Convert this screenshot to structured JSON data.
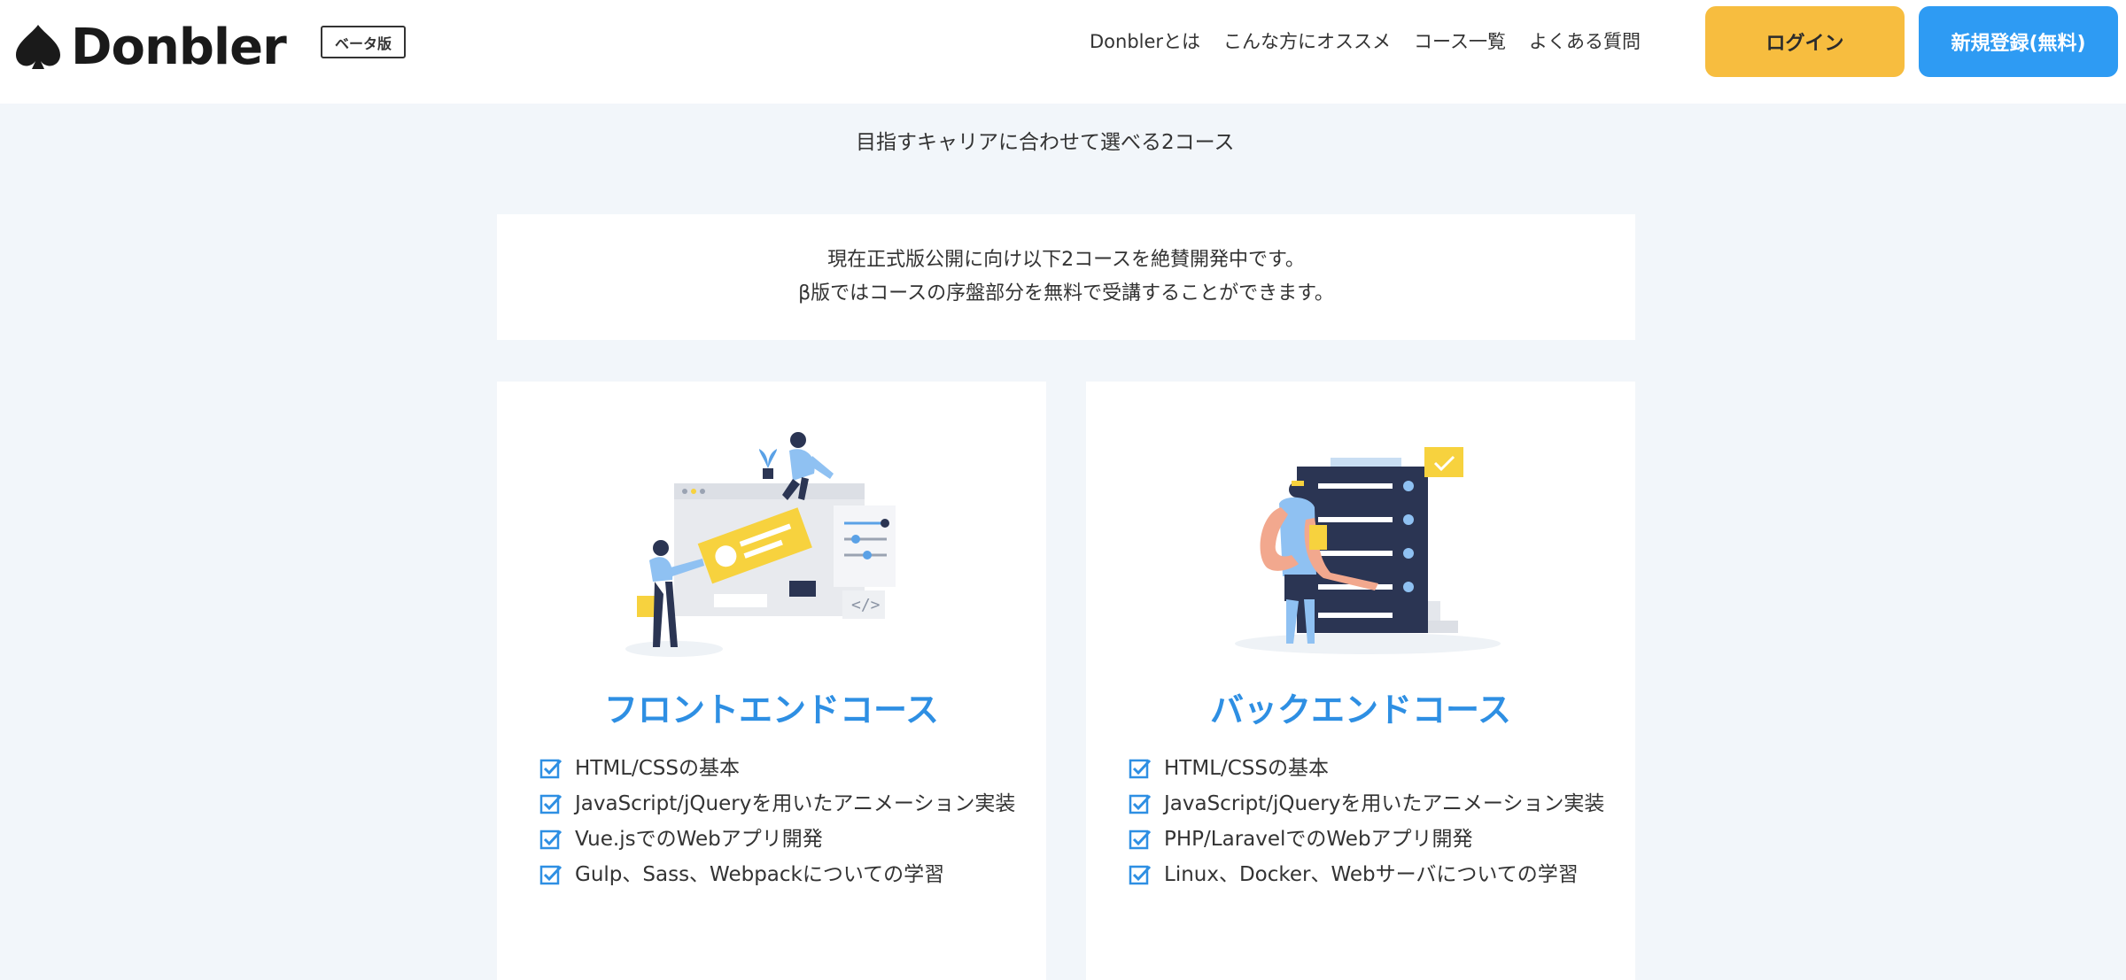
{
  "header": {
    "brand": "Donbler",
    "beta_label": "ベータ版",
    "nav": [
      "Donblerとは",
      "こんな方にオススメ",
      "コース一覧",
      "よくある質問"
    ],
    "login_label": "ログイン",
    "signup_label": "新規登録(無料)"
  },
  "subtitle": "目指すキャリアに合わせて選べる2コース",
  "notice": {
    "line1": "現在正式版公開に向け以下2コースを絶賛開発中です。",
    "line2": "β版ではコースの序盤部分を無料で受講することができます。"
  },
  "courses": [
    {
      "title": "フロントエンドコース",
      "features": [
        "HTML/CSSの基本",
        "JavaScript/jQueryを用いたアニメーション実装",
        "Vue.jsでのWebアプリ開発",
        "Gulp、Sass、Webpackについての学習"
      ]
    },
    {
      "title": "バックエンドコース",
      "features": [
        "HTML/CSSの基本",
        "JavaScript/jQueryを用いたアニメーション実装",
        "PHP/LaravelでのWebアプリ開発",
        "Linux、Docker、Webサーバについての学習"
      ]
    }
  ],
  "colors": {
    "accent_blue": "#2e9bf3",
    "login_yellow": "#f7bd3f",
    "title_blue": "#2e8fe3",
    "background": "#f2f6fa"
  }
}
